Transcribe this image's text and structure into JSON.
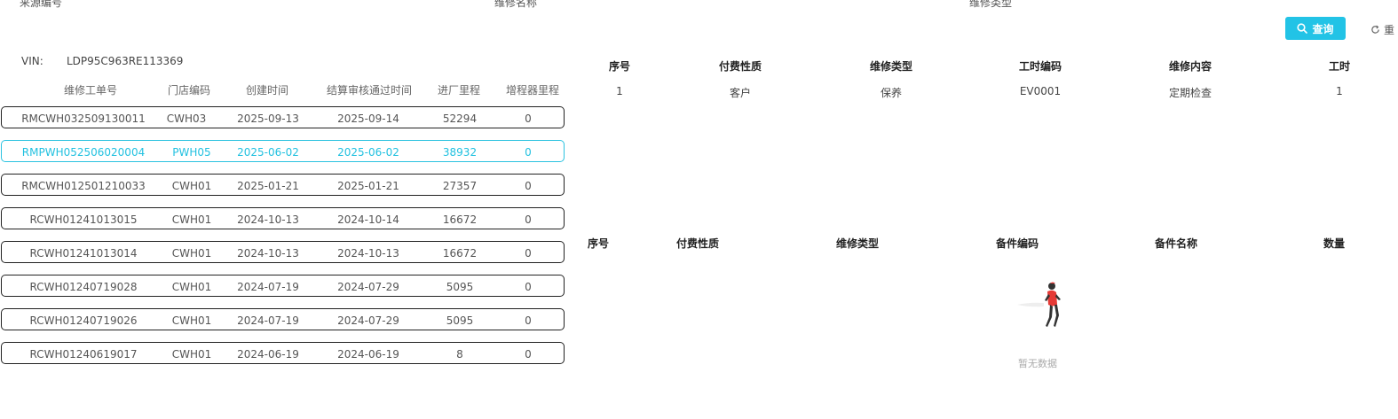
{
  "top_labels": [
    "来源编号",
    "维修名称",
    "维修类型"
  ],
  "search": {
    "query_label": "查询",
    "reset_label": "重"
  },
  "vin": {
    "label": "VIN:",
    "value": "LDP95C963RE113369"
  },
  "orders": {
    "columns": [
      "维修工单号",
      "门店编码",
      "创建时间",
      "结算审核通过时间",
      "进厂里程",
      "增程器里程"
    ],
    "rows": [
      [
        "RMCWH032509130011",
        "CWH03",
        "2025-09-13",
        "2025-09-14",
        "52294",
        "0"
      ],
      [
        "RMPWH052506020004",
        "PWH05",
        "2025-06-02",
        "2025-06-02",
        "38932",
        "0"
      ],
      [
        "RMCWH012501210033",
        "CWH01",
        "2025-01-21",
        "2025-01-21",
        "27357",
        "0"
      ],
      [
        "RCWH01241013015",
        "CWH01",
        "2024-10-13",
        "2024-10-14",
        "16672",
        "0"
      ],
      [
        "RCWH01241013014",
        "CWH01",
        "2024-10-13",
        "2024-10-13",
        "16672",
        "0"
      ],
      [
        "RCWH01240719028",
        "CWH01",
        "2024-07-19",
        "2024-07-29",
        "5095",
        "0"
      ],
      [
        "RCWH01240719026",
        "CWH01",
        "2024-07-19",
        "2024-07-29",
        "5095",
        "0"
      ],
      [
        "RCWH01240619017",
        "CWH01",
        "2024-06-19",
        "2024-06-19",
        "8",
        "0"
      ]
    ],
    "selected_index": 1
  },
  "labor": {
    "columns": [
      "序号",
      "付费性质",
      "维修类型",
      "工时编码",
      "维修内容",
      "工时"
    ],
    "rows": [
      [
        "1",
        "客户",
        "保养",
        "EV0001",
        "定期检查",
        "1"
      ]
    ]
  },
  "parts": {
    "columns": [
      "序号",
      "付费性质",
      "维修类型",
      "备件编码",
      "备件名称",
      "数量"
    ],
    "rows": [],
    "empty_text": "暂无数据"
  },
  "colors": {
    "accent": "#22c3e6",
    "row_border": "#222222",
    "selected_text": "#22c1e0"
  }
}
